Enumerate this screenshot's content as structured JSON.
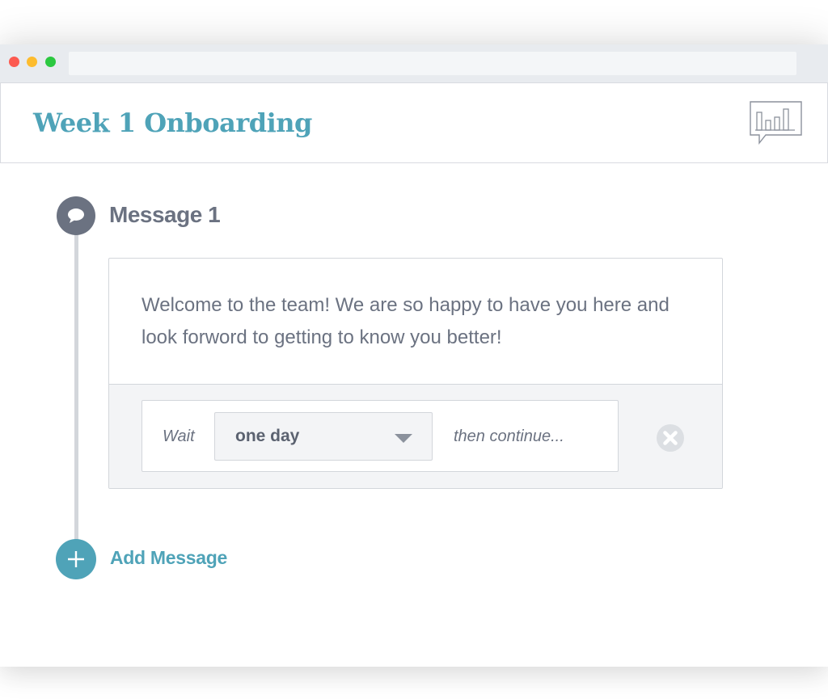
{
  "header": {
    "title": "Week 1 Onboarding"
  },
  "message": {
    "title": "Message 1",
    "body": "Welcome to the team! We are so happy to have you here and look forword to getting to know you better!",
    "delay": {
      "wait_label": "Wait",
      "selected_value": "one day",
      "continue_label": "then continue..."
    }
  },
  "actions": {
    "add_message_label": "Add Message"
  },
  "icons": {
    "message": "chat-bubble-icon",
    "stats": "bar-chart-speech-icon",
    "remove": "close-circle-icon",
    "add": "plus-icon",
    "dropdown": "chevron-down-icon"
  },
  "colors": {
    "accent": "#4fa3b8",
    "text": "#6b7281",
    "border": "#d3d6db",
    "footer_bg": "#f3f4f6"
  }
}
